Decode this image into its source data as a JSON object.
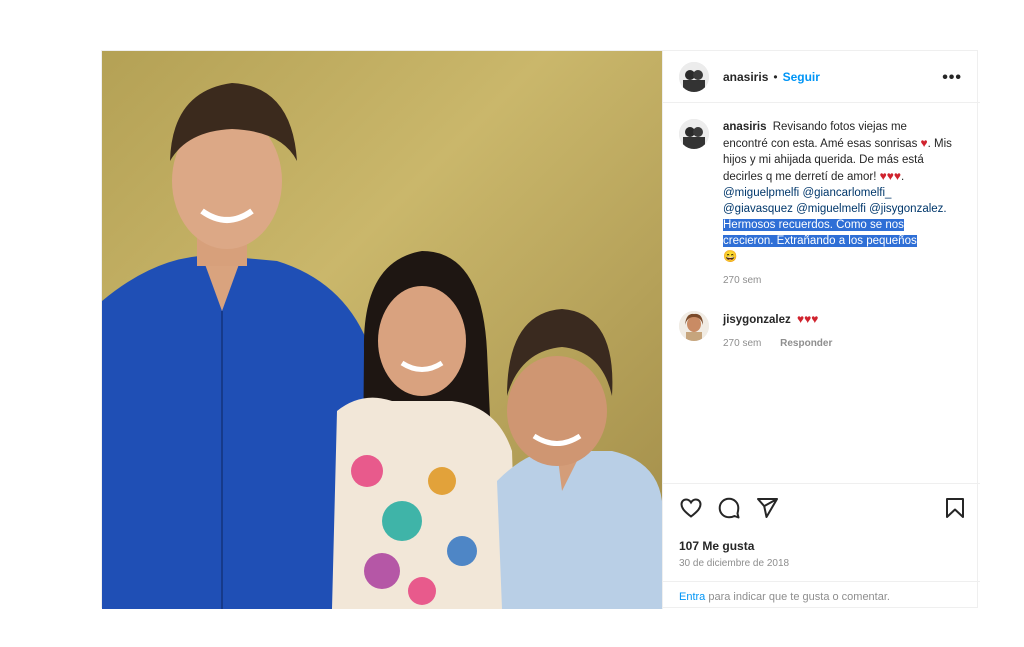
{
  "post": {
    "author": "anasiris",
    "dot": "•",
    "follow_label": "Seguir",
    "more_icon": "more-icon"
  },
  "caption": {
    "username": "anasiris",
    "text_1": "Revisando fotos viejas me encontré con esta. Amé esas sonrisas",
    "heart": "♥",
    "text_2": ". Mis hijos y mi ahijada querida. De más está decirles q me derretí de amor!",
    "hearts": "♥♥♥",
    "text_3": ".",
    "mentions": [
      "@miguelpmelfi",
      "@giancarlomelfi_",
      "@giavasquez",
      "@miguelmelfi",
      "@jisygonzalez."
    ],
    "highlight": "Hermosos recuerdos. Como se nos crecieron. Extrañando a los pequeños",
    "emoji": "😄",
    "time": "270 sem"
  },
  "comments": [
    {
      "username": "jisygonzalez",
      "text": "♥♥♥",
      "time": "270 sem",
      "reply_label": "Responder"
    }
  ],
  "stats": {
    "likes": "107 Me gusta",
    "date": "30 de diciembre de 2018"
  },
  "footer": {
    "enter_label": "Entra",
    "rest": " para indicar que te gusta o comentar."
  },
  "colors": {
    "accent": "#0095f6",
    "heart": "#d0232e",
    "highlight": "#2f6fd6"
  }
}
